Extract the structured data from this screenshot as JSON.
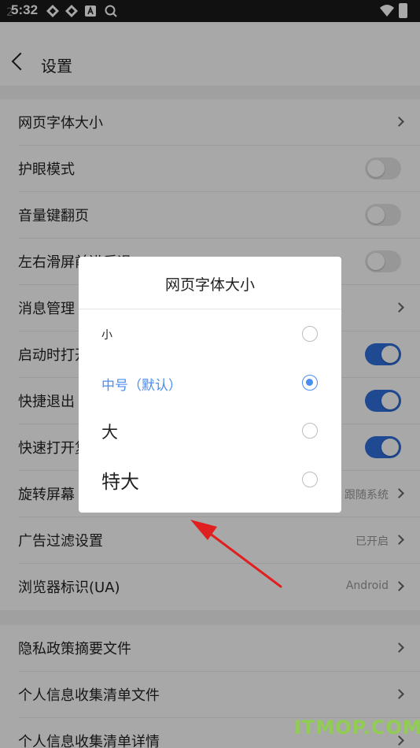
{
  "status": {
    "time": "5:32"
  },
  "header": {
    "title": "设置"
  },
  "settings": [
    {
      "label": "网页字体大小",
      "control": "chevron"
    },
    {
      "label": "护眼模式",
      "control": "toggle",
      "on": false
    },
    {
      "label": "音量键翻页",
      "control": "toggle",
      "on": false
    },
    {
      "label": "左右滑屏前进后退",
      "control": "toggle",
      "on": false
    },
    {
      "label": "消息管理",
      "control": "chevron"
    },
    {
      "label": "启动时打开",
      "control": "toggle",
      "on": true
    },
    {
      "label": "快捷退出",
      "control": "toggle",
      "on": true
    },
    {
      "label": "快速打开复",
      "control": "toggle",
      "on": true
    },
    {
      "label": "旋转屏幕",
      "value": "跟随系统",
      "control": "chevron"
    },
    {
      "label": "广告过滤设置",
      "value": "已开启",
      "control": "chevron"
    },
    {
      "label": "浏览器标识(UA)",
      "value": "Android",
      "control": "chevron"
    }
  ],
  "settings2": [
    {
      "label": "隐私政策摘要文件",
      "control": "chevron"
    },
    {
      "label": "个人信息收集清单文件",
      "control": "chevron"
    },
    {
      "label": "个人信息收集清单详情",
      "control": "chevron"
    }
  ],
  "dialog": {
    "title": "网页字体大小",
    "options": [
      {
        "label": "小",
        "selected": false
      },
      {
        "label": "中号（默认）",
        "selected": true
      },
      {
        "label": "大",
        "selected": false
      },
      {
        "label": "特大",
        "selected": false
      }
    ]
  },
  "watermark": "ITMOP.COM",
  "colors": {
    "accent": "#4a8df0",
    "toggle_on": "#2f6fdc",
    "annotation": "#e02020"
  }
}
